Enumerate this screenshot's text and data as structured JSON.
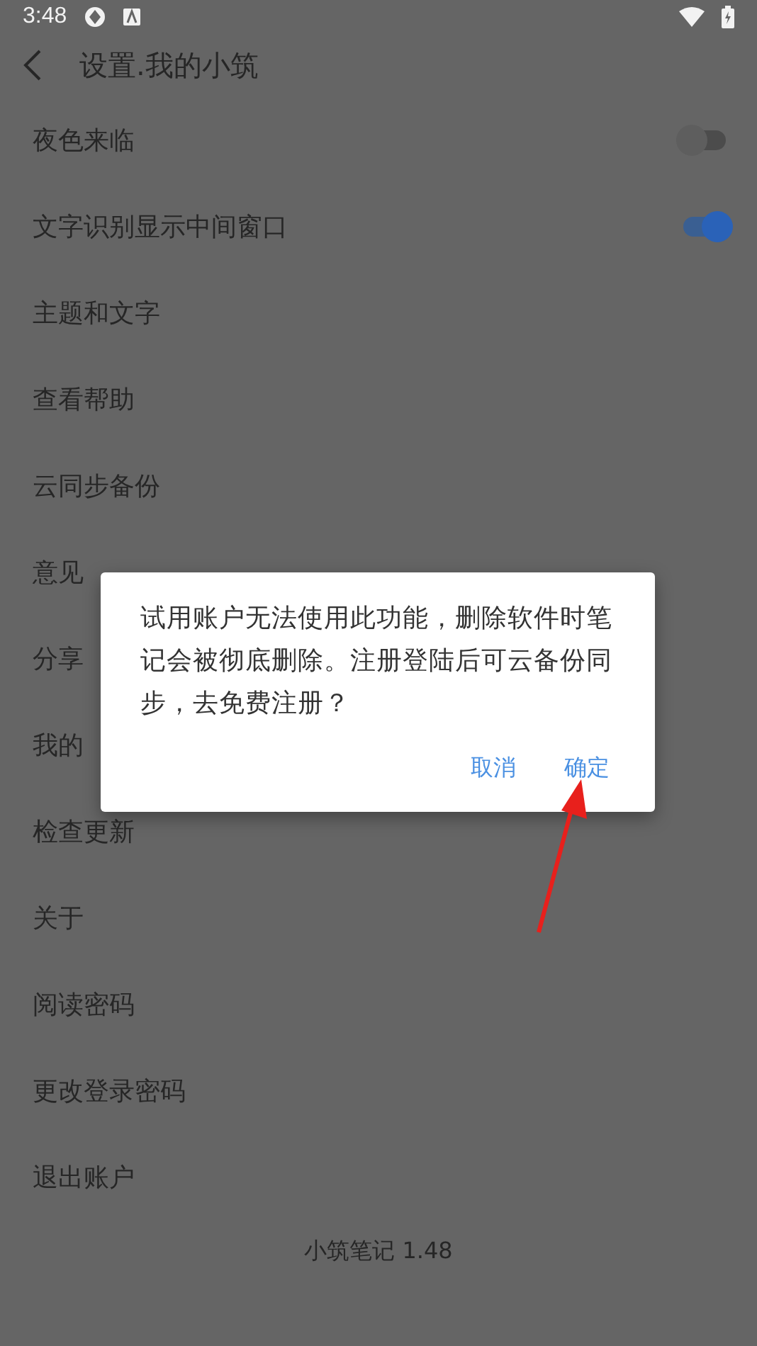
{
  "status_bar": {
    "time": "3:48"
  },
  "header": {
    "title": "设置.我的小筑"
  },
  "settings": [
    {
      "kind": "toggle",
      "label": "夜色来临",
      "on": false
    },
    {
      "kind": "toggle",
      "label": "文字识别显示中间窗口",
      "on": true
    },
    {
      "kind": "link",
      "label": "主题和文字"
    },
    {
      "kind": "link",
      "label": "查看帮助"
    },
    {
      "kind": "link",
      "label": "云同步备份"
    },
    {
      "kind": "link",
      "label": "意见"
    },
    {
      "kind": "link",
      "label": "分享"
    },
    {
      "kind": "link",
      "label": "我的"
    },
    {
      "kind": "link",
      "label": "检查更新"
    },
    {
      "kind": "link",
      "label": "关于"
    },
    {
      "kind": "link",
      "label": "阅读密码"
    },
    {
      "kind": "link",
      "label": "更改登录密码"
    },
    {
      "kind": "link",
      "label": "退出账户"
    }
  ],
  "footer": "小筑笔记 1.48",
  "dialog": {
    "message": "试用账户无法使用此功能，删除软件时笔记会被彻底删除。注册登陆后可云备份同步，去免费注册？",
    "buttons": [
      "取消",
      "确定"
    ]
  }
}
